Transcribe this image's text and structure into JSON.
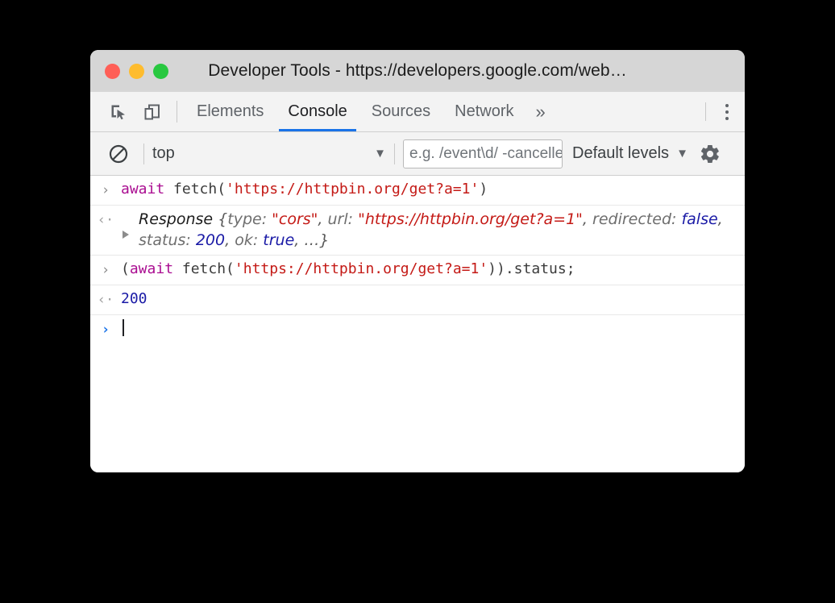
{
  "window": {
    "title": "Developer Tools - https://developers.google.com/web…",
    "traffic_lights": [
      {
        "name": "close",
        "color": "#ff5f57"
      },
      {
        "name": "minimize",
        "color": "#febc2e"
      },
      {
        "name": "maximize",
        "color": "#28c840"
      }
    ]
  },
  "toolbar": {
    "inspect_icon": "inspect-element-icon",
    "device_icon": "device-toolbar-icon",
    "tabs": [
      {
        "label": "Elements",
        "active": false
      },
      {
        "label": "Console",
        "active": true
      },
      {
        "label": "Sources",
        "active": false
      },
      {
        "label": "Network",
        "active": false
      }
    ],
    "more_tabs_label": "»",
    "menu_icon": "kebab-menu-icon",
    "active_tab_color": "#1a73e8"
  },
  "filterbar": {
    "clear_icon": "clear-console-icon",
    "context": "top",
    "context_caret": "▼",
    "filter_placeholder": "e.g. /event\\d/ -cancelled",
    "levels_label": "Default levels",
    "levels_caret": "▼",
    "settings_icon": "gear-icon"
  },
  "console": {
    "entries": [
      {
        "type": "input",
        "gutter": "›",
        "tokens": [
          {
            "text": "await",
            "style": "kw"
          },
          {
            "text": " fetch(",
            "style": "plain"
          },
          {
            "text": "'https://httpbin.org/get?a=1'",
            "style": "str"
          },
          {
            "text": ")",
            "style": "plain"
          }
        ]
      },
      {
        "type": "output",
        "gutter": "‹·",
        "expandable": true,
        "tokens": [
          {
            "text": "Response ",
            "style": "cls"
          },
          {
            "text": "{",
            "style": "punc"
          },
          {
            "text": "type: ",
            "style": "prop"
          },
          {
            "text": "\"cors\"",
            "style": "str"
          },
          {
            "text": ", ",
            "style": "punc"
          },
          {
            "text": "url: ",
            "style": "prop"
          },
          {
            "text": "\"https://httpbin.org/get?a=1\"",
            "style": "str"
          },
          {
            "text": ", ",
            "style": "punc"
          },
          {
            "text": "redirected: ",
            "style": "prop"
          },
          {
            "text": "false",
            "style": "bool"
          },
          {
            "text": ", ",
            "style": "punc"
          },
          {
            "text": "status: ",
            "style": "prop"
          },
          {
            "text": "200",
            "style": "num"
          },
          {
            "text": ", ",
            "style": "punc"
          },
          {
            "text": "ok: ",
            "style": "prop"
          },
          {
            "text": "true",
            "style": "bool"
          },
          {
            "text": ", …}",
            "style": "punc"
          }
        ]
      },
      {
        "type": "input",
        "gutter": "›",
        "tokens": [
          {
            "text": "(",
            "style": "plain"
          },
          {
            "text": "await",
            "style": "kw"
          },
          {
            "text": " fetch(",
            "style": "plain"
          },
          {
            "text": "'https://httpbin.org/get?a=1'",
            "style": "str"
          },
          {
            "text": ")).status;",
            "style": "plain"
          }
        ]
      },
      {
        "type": "output",
        "gutter": "‹·",
        "expandable": false,
        "tokens": [
          {
            "text": "200",
            "style": "num"
          }
        ]
      }
    ],
    "prompt": {
      "gutter": "›",
      "value": ""
    }
  }
}
